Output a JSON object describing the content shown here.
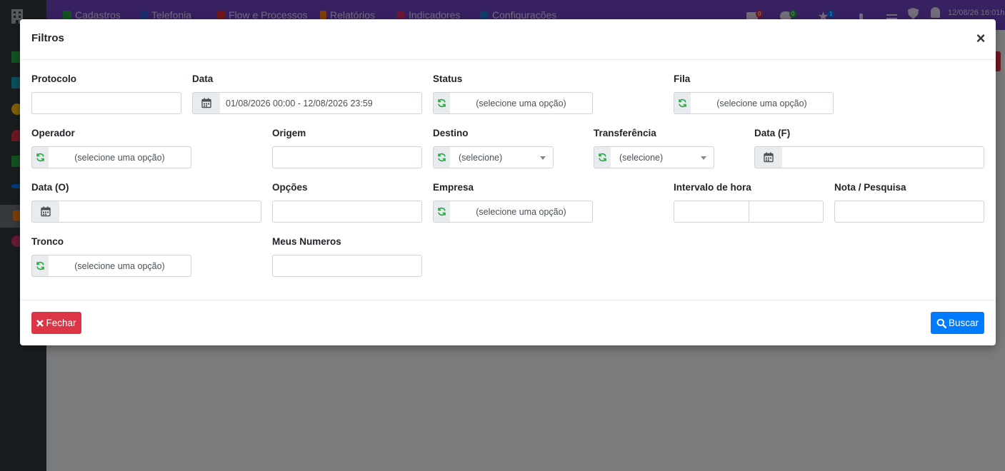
{
  "app": {
    "nav": [
      {
        "label": "Cadastros",
        "color": "#28a745"
      },
      {
        "label": "Telefonia",
        "color": "#3b5bdb"
      },
      {
        "label": "Flow e Processos",
        "color": "#e03131"
      },
      {
        "label": "Relatórios",
        "color": "#fd7e14"
      },
      {
        "label": "Indicadores",
        "color": "#d6336c"
      },
      {
        "label": "Configurações",
        "color": "#1c7ed6"
      }
    ],
    "badges": {
      "mail": "0",
      "chat": "0",
      "star": "1"
    },
    "datetime": "12/08/26 16:01h"
  },
  "modal": {
    "title": "Filtros",
    "close_symbol": "×",
    "fields": {
      "protocolo": {
        "label": "Protocolo",
        "value": ""
      },
      "data": {
        "label": "Data",
        "value": "01/08/2026 00:00 - 12/08/2026 23:59"
      },
      "status": {
        "label": "Status",
        "placeholder": "(selecione uma opção)"
      },
      "fila": {
        "label": "Fila",
        "placeholder": "(selecione uma opção)"
      },
      "operador": {
        "label": "Operador",
        "placeholder": "(selecione uma opção)"
      },
      "origem": {
        "label": "Origem",
        "value": ""
      },
      "destino": {
        "label": "Destino",
        "selected": "(selecione)"
      },
      "transferencia": {
        "label": "Transferência",
        "selected": "(selecione)"
      },
      "data_f": {
        "label": "Data (F)",
        "value": ""
      },
      "data_o": {
        "label": "Data (O)",
        "value": ""
      },
      "opcoes": {
        "label": "Opções",
        "value": ""
      },
      "empresa": {
        "label": "Empresa",
        "placeholder": "(selecione uma opção)"
      },
      "intervalo_hora": {
        "label": "Intervalo de hora",
        "start": "",
        "end": ""
      },
      "nota_pesquisa": {
        "label": "Nota / Pesquisa",
        "value": ""
      },
      "tronco": {
        "label": "Tronco",
        "placeholder": "(selecione uma opção)"
      },
      "meus_numeros": {
        "label": "Meus Numeros",
        "value": ""
      }
    },
    "buttons": {
      "fechar": "Fechar",
      "buscar": "Buscar"
    },
    "colors": {
      "danger": "#dc3545",
      "primary": "#007bff",
      "refresh_icon": "#28a745"
    }
  }
}
